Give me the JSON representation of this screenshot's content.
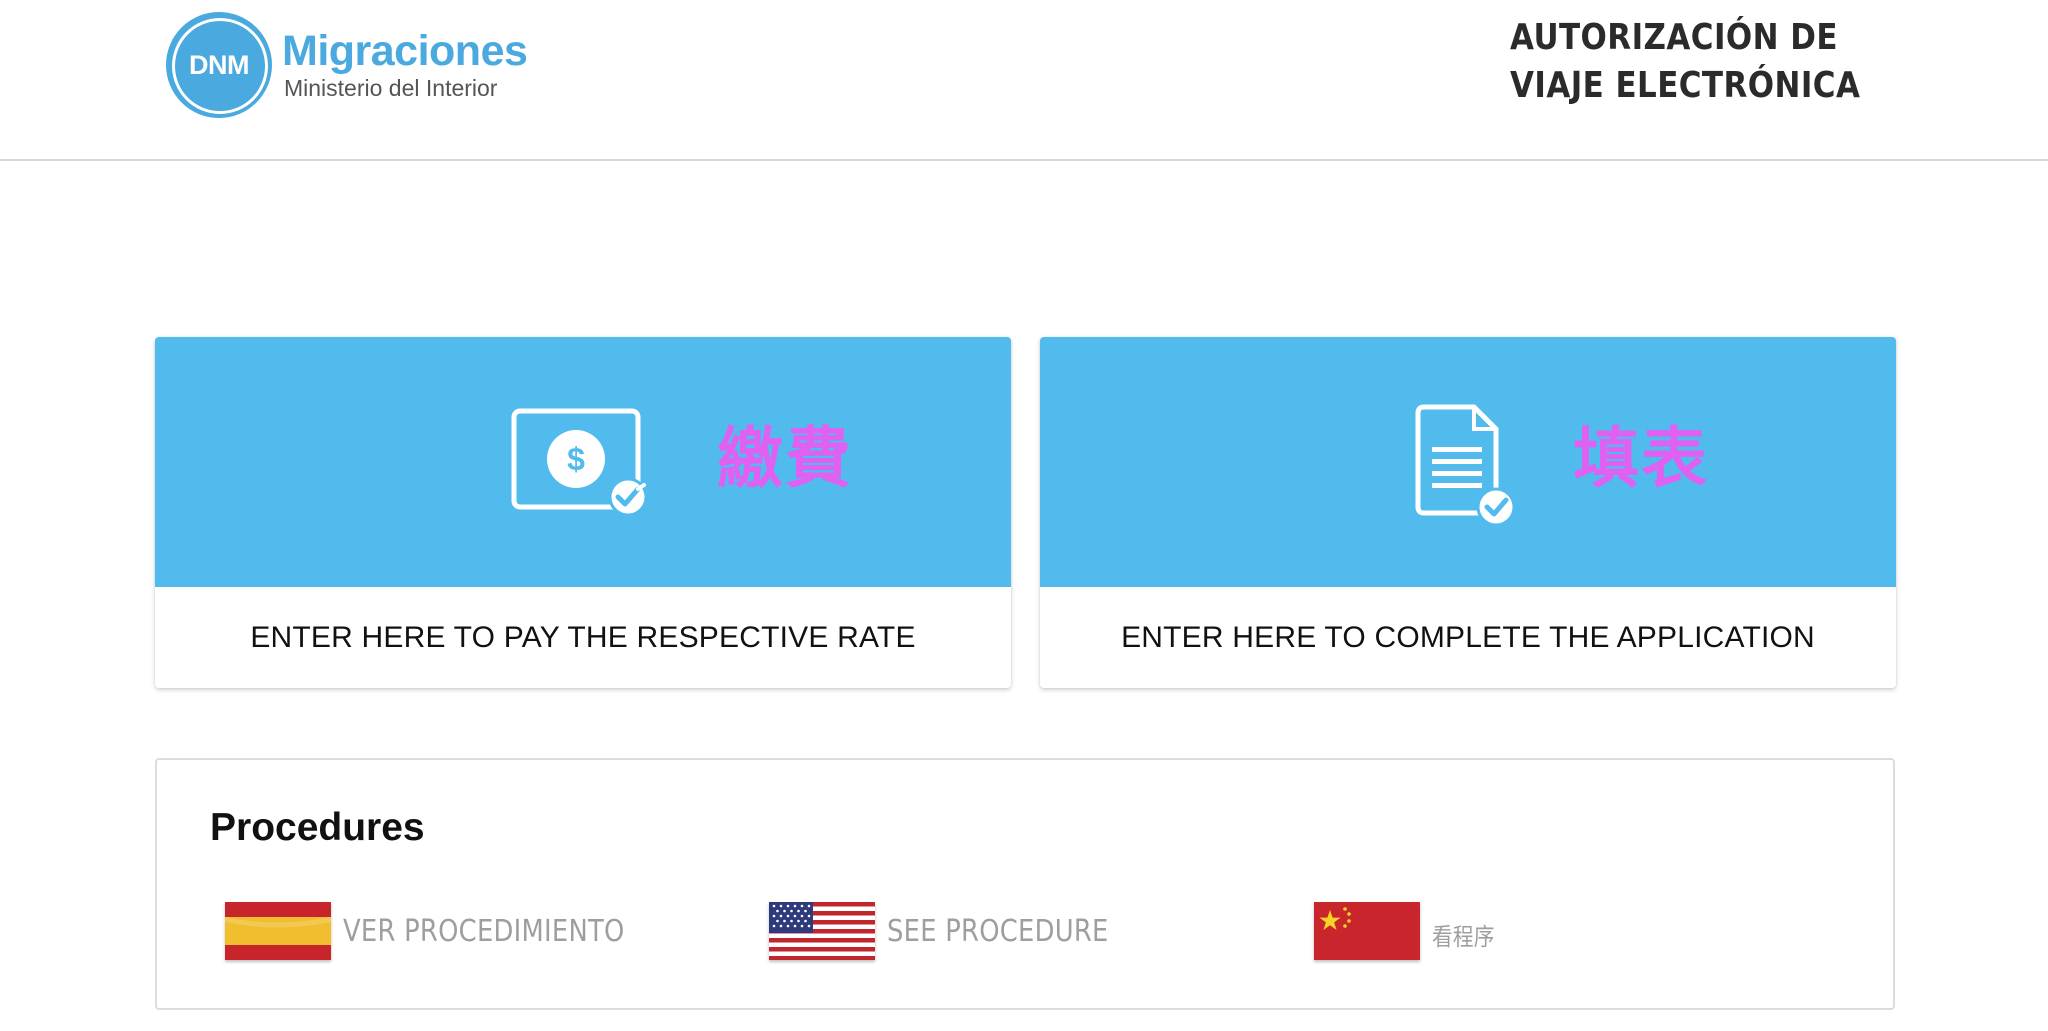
{
  "header": {
    "logo_abbrev": "DNM",
    "logo_title": "Migraciones",
    "logo_subtitle": "Ministerio del Interior",
    "page_title_line1": "AUTORIZACIÓN DE",
    "page_title_line2": "VIAJE ELECTRÓNICA"
  },
  "cards": {
    "pay": {
      "icon": "dollar-certificate-icon",
      "cjk_label": "繳費",
      "label": "ENTER HERE TO PAY THE RESPECTIVE RATE"
    },
    "apply": {
      "icon": "document-check-icon",
      "cjk_label": "填表",
      "label": "ENTER HERE TO COMPLETE THE APPLICATION"
    }
  },
  "procedures": {
    "title": "Procedures",
    "links": [
      {
        "flag": "spain-flag-icon",
        "label": "VER PROCEDIMIENTO"
      },
      {
        "flag": "usa-flag-icon",
        "label": "SEE PROCEDURE"
      },
      {
        "flag": "china-flag-icon",
        "label": "看程序"
      }
    ]
  },
  "colors": {
    "card_blue": "#52bbed",
    "logo_blue": "#4aa9de",
    "cjk_magenta": "#e060f2",
    "link_gray": "#9e9e9e"
  }
}
